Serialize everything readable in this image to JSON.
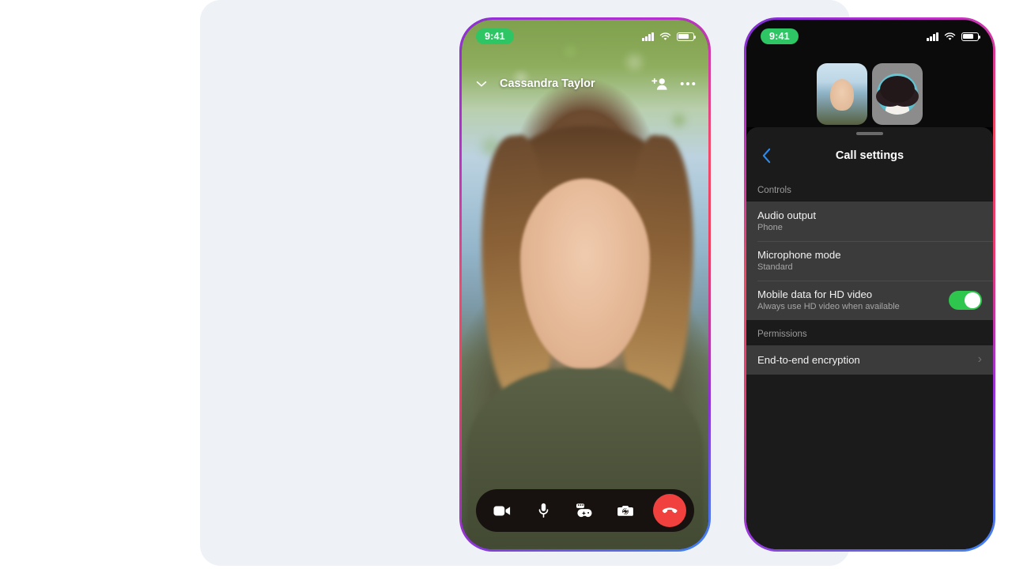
{
  "left_phone": {
    "status_bar": {
      "time": "9:41",
      "icons": [
        "cellular-signal-icon",
        "wifi-icon",
        "battery-icon"
      ]
    },
    "call_header": {
      "minimize_icon": "chevron-down-icon",
      "contact_name": "Cassandra Taylor",
      "add_person_icon": "add-person-icon",
      "more_icon": "more-options-icon"
    },
    "controls": [
      {
        "name": "video-camera-button",
        "icon": "video-camera-icon"
      },
      {
        "name": "microphone-button",
        "icon": "microphone-icon"
      },
      {
        "name": "effects-button",
        "icon": "game-controller-icon"
      },
      {
        "name": "flip-camera-button",
        "icon": "flip-camera-icon"
      },
      {
        "name": "end-call-button",
        "icon": "phone-hangup-icon"
      }
    ],
    "end_call_color": "#f0413f"
  },
  "right_phone": {
    "status_bar": {
      "time": "9:41",
      "icons": [
        "cellular-signal-icon",
        "wifi-icon",
        "battery-icon"
      ]
    },
    "participants": [
      {
        "name": "participant-thumbnail-1"
      },
      {
        "name": "participant-thumbnail-2"
      }
    ],
    "sheet": {
      "back_icon": "back-chevron-icon",
      "title": "Call settings",
      "sections": [
        {
          "header": "Controls",
          "rows": [
            {
              "title": "Audio output",
              "subtitle": "Phone",
              "accessory": "none"
            },
            {
              "title": "Microphone mode",
              "subtitle": "Standard",
              "accessory": "none"
            },
            {
              "title": "Mobile data for HD video",
              "subtitle": "Always use HD video when available",
              "accessory": "toggle",
              "toggle_on": true
            }
          ]
        },
        {
          "header": "Permissions",
          "rows": [
            {
              "title": "End-to-end encryption",
              "subtitle": "",
              "accessory": "chevron",
              "chevron": "›"
            }
          ]
        }
      ]
    },
    "toggle_on_color": "#2ec64d"
  },
  "theme": {
    "stage_background": "#eef2f6",
    "sheet_background": "#1b1b1b",
    "row_background": "#3b3b3b",
    "accent_blue": "#2b8cf0"
  }
}
